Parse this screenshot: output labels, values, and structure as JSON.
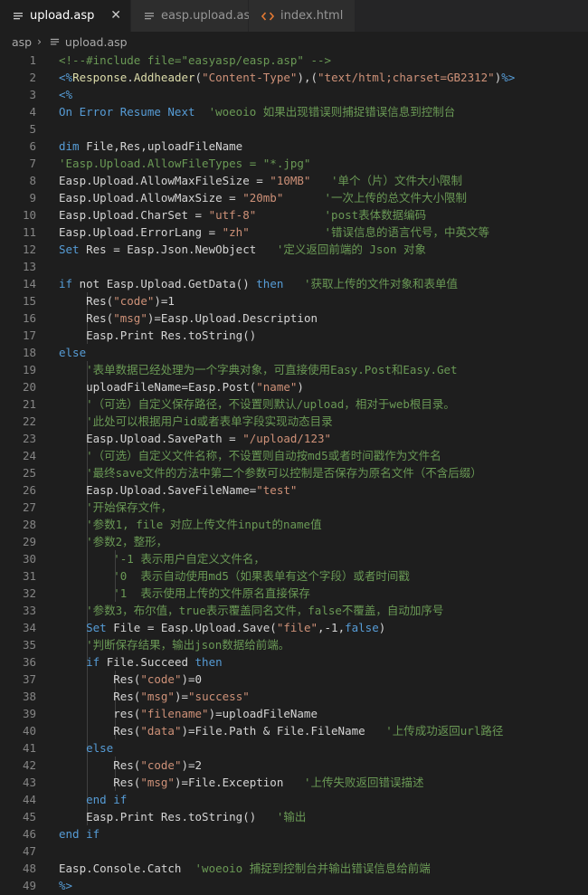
{
  "tabs": [
    {
      "label": "upload.asp",
      "active": true,
      "icon": "lines-icon",
      "close": "✕"
    },
    {
      "label": "easp.upload.asp",
      "active": false,
      "icon": "lines-icon"
    },
    {
      "label": "index.html",
      "active": false,
      "icon": "code-brackets-icon"
    }
  ],
  "breadcrumb": {
    "folder": "asp",
    "file": "upload.asp"
  },
  "colors": {
    "comment": "#6a9955",
    "keyword": "#569cd6",
    "string": "#ce9178",
    "function": "#dcdcaa",
    "text": "#d4d4d4",
    "line_number": "#858585"
  },
  "lines": [
    [
      [
        "c",
        "<!--#include file=\"easyasp/easp.asp\" -->"
      ]
    ],
    [
      [
        "k",
        "<%"
      ],
      [
        "f",
        "Response"
      ],
      [
        "p",
        "."
      ],
      [
        "f",
        "Addheader"
      ],
      [
        "p",
        "("
      ],
      [
        "s",
        "\"Content-Type\""
      ],
      [
        "p",
        "),("
      ],
      [
        "s",
        "\"text/html;charset=GB2312\""
      ],
      [
        "p",
        ")"
      ],
      [
        "k",
        "%>"
      ]
    ],
    [
      [
        "k",
        "<%"
      ]
    ],
    [
      [
        "k",
        "On Error Resume Next"
      ],
      [
        "p",
        "  "
      ],
      [
        "c",
        "'woeoio 如果出现错误则捕捉错误信息到控制台"
      ]
    ],
    [],
    [
      [
        "k",
        "dim"
      ],
      [
        "p",
        " File,Res,uploadFileName"
      ]
    ],
    [
      [
        "c",
        "'Easp.Upload.AllowFileTypes = \"*.jpg\""
      ]
    ],
    [
      [
        "p",
        "Easp.Upload.AllowMaxFileSize = "
      ],
      [
        "s",
        "\"10MB\""
      ],
      [
        "p",
        "   "
      ],
      [
        "c",
        "'单个（片）文件大小限制"
      ]
    ],
    [
      [
        "p",
        "Easp.Upload.AllowMaxSize = "
      ],
      [
        "s",
        "\"20mb\""
      ],
      [
        "p",
        "      "
      ],
      [
        "c",
        "'一次上传的总文件大小限制"
      ]
    ],
    [
      [
        "p",
        "Easp.Upload.CharSet = "
      ],
      [
        "s",
        "\"utf-8\""
      ],
      [
        "p",
        "          "
      ],
      [
        "c",
        "'post表体数据编码"
      ]
    ],
    [
      [
        "p",
        "Easp.Upload.ErrorLang = "
      ],
      [
        "s",
        "\"zh\""
      ],
      [
        "p",
        "           "
      ],
      [
        "c",
        "'错误信息的语言代号，中英文等"
      ]
    ],
    [
      [
        "k",
        "Set"
      ],
      [
        "p",
        " Res = Easp.Json.NewObject   "
      ],
      [
        "c",
        "'定义返回前端的 Json 对象"
      ]
    ],
    [],
    [
      [
        "k",
        "if"
      ],
      [
        "p",
        " not Easp.Upload.GetData() "
      ],
      [
        "k",
        "then"
      ],
      [
        "p",
        "   "
      ],
      [
        "c",
        "'获取上传的文件对象和表单值"
      ]
    ],
    [
      [
        "p",
        "    Res("
      ],
      [
        "s",
        "\"code\""
      ],
      [
        "p",
        ")=1"
      ]
    ],
    [
      [
        "p",
        "    Res("
      ],
      [
        "s",
        "\"msg\""
      ],
      [
        "p",
        ")=Easp.Upload.Description"
      ]
    ],
    [
      [
        "p",
        "    Easp.Print Res.toString()"
      ]
    ],
    [
      [
        "k",
        "else"
      ]
    ],
    [
      [
        "p",
        "    "
      ],
      [
        "c",
        "'表单数据已经处理为一个字典对象，可直接使用Easy.Post和Easy.Get"
      ]
    ],
    [
      [
        "p",
        "    uploadFileName=Easp.Post("
      ],
      [
        "s",
        "\"name\""
      ],
      [
        "p",
        ")"
      ]
    ],
    [
      [
        "p",
        "    "
      ],
      [
        "c",
        "'（可选）自定义保存路径，不设置则默认/upload，相对于web根目录。"
      ]
    ],
    [
      [
        "p",
        "    "
      ],
      [
        "c",
        "'此处可以根据用户id或者表单字段实现动态目录"
      ]
    ],
    [
      [
        "p",
        "    Easp.Upload.SavePath = "
      ],
      [
        "s",
        "\"/upload/123\""
      ]
    ],
    [
      [
        "p",
        "    "
      ],
      [
        "c",
        "'（可选）自定义文件名称，不设置则自动按md5或者时间戳作为文件名"
      ]
    ],
    [
      [
        "p",
        "    "
      ],
      [
        "c",
        "'最终save文件的方法中第二个参数可以控制是否保存为原名文件（不含后缀）"
      ]
    ],
    [
      [
        "p",
        "    Easp.Upload.SaveFileName="
      ],
      [
        "s",
        "\"test\""
      ]
    ],
    [
      [
        "p",
        "    "
      ],
      [
        "c",
        "'开始保存文件，"
      ]
    ],
    [
      [
        "p",
        "    "
      ],
      [
        "c",
        "'参数1, file 对应上传文件input的name值"
      ]
    ],
    [
      [
        "p",
        "    "
      ],
      [
        "c",
        "'参数2，整形，"
      ]
    ],
    [
      [
        "p",
        "        "
      ],
      [
        "c",
        "'-1 表示用户自定义文件名，"
      ]
    ],
    [
      [
        "p",
        "        "
      ],
      [
        "c",
        "'0  表示自动使用md5（如果表单有这个字段）或者时间戳"
      ]
    ],
    [
      [
        "p",
        "        "
      ],
      [
        "c",
        "'1  表示使用上传的文件原名直接保存"
      ]
    ],
    [
      [
        "p",
        "    "
      ],
      [
        "c",
        "'参数3，布尔值，true表示覆盖同名文件，false不覆盖，自动加序号"
      ]
    ],
    [
      [
        "p",
        "    "
      ],
      [
        "k",
        "Set"
      ],
      [
        "p",
        " File = Easp.Upload.Save("
      ],
      [
        "s",
        "\"file\""
      ],
      [
        "p",
        ",-1,"
      ],
      [
        "k",
        "false"
      ],
      [
        "p",
        ")"
      ]
    ],
    [
      [
        "p",
        "    "
      ],
      [
        "c",
        "'判断保存结果，输出json数据给前端。"
      ]
    ],
    [
      [
        "p",
        "    "
      ],
      [
        "k",
        "if"
      ],
      [
        "p",
        " File.Succeed "
      ],
      [
        "k",
        "then"
      ]
    ],
    [
      [
        "p",
        "        Res("
      ],
      [
        "s",
        "\"code\""
      ],
      [
        "p",
        ")=0"
      ]
    ],
    [
      [
        "p",
        "        Res("
      ],
      [
        "s",
        "\"msg\""
      ],
      [
        "p",
        ")="
      ],
      [
        "s",
        "\"success\""
      ]
    ],
    [
      [
        "p",
        "        res("
      ],
      [
        "s",
        "\"filename\""
      ],
      [
        "p",
        ")=uploadFileName"
      ]
    ],
    [
      [
        "p",
        "        Res("
      ],
      [
        "s",
        "\"data\""
      ],
      [
        "p",
        ")=File.Path & File.FileName   "
      ],
      [
        "c",
        "'上传成功返回url路径"
      ]
    ],
    [
      [
        "p",
        "    "
      ],
      [
        "k",
        "else"
      ]
    ],
    [
      [
        "p",
        "        Res("
      ],
      [
        "s",
        "\"code\""
      ],
      [
        "p",
        ")=2"
      ]
    ],
    [
      [
        "p",
        "        Res("
      ],
      [
        "s",
        "\"msg\""
      ],
      [
        "p",
        ")=File.Exception   "
      ],
      [
        "c",
        "'上传失败返回错误描述"
      ]
    ],
    [
      [
        "p",
        "    "
      ],
      [
        "k",
        "end if"
      ]
    ],
    [
      [
        "p",
        "    Easp.Print Res.toString()   "
      ],
      [
        "c",
        "'输出"
      ]
    ],
    [
      [
        "k",
        "end if"
      ]
    ],
    [],
    [
      [
        "p",
        "Easp.Console.Catch  "
      ],
      [
        "c",
        "'woeoio 捕捉到控制台并输出错误信息给前端"
      ]
    ],
    [
      [
        "k",
        "%>"
      ]
    ]
  ]
}
